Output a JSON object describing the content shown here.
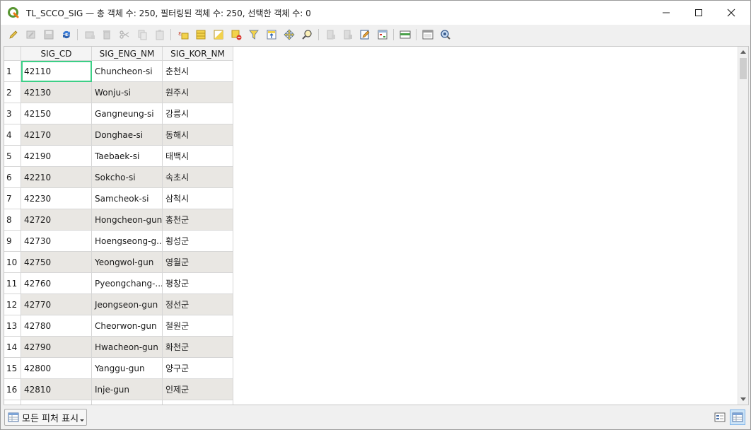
{
  "window": {
    "title": "TL_SCCO_SIG — 총 객체 수: 250, 필터링된 객체 수: 250, 선택한 객체 수: 0"
  },
  "toolbar": {
    "buttons": [
      {
        "name": "toggle-editing-button",
        "icon": "pencil-icon"
      },
      {
        "name": "toggle-multi-edit-button",
        "icon": "multi-edit-icon"
      },
      {
        "name": "save-edits-button",
        "icon": "save-icon"
      },
      {
        "name": "reload-table-button",
        "icon": "reload-icon"
      },
      {
        "name": "add-feature-button",
        "icon": "add-feature-icon"
      },
      {
        "name": "delete-features-button",
        "icon": "delete-icon"
      },
      {
        "name": "cut-features-button",
        "icon": "cut-icon"
      },
      {
        "name": "copy-features-button",
        "icon": "copy-icon"
      },
      {
        "name": "paste-features-button",
        "icon": "paste-icon"
      },
      {
        "name": "select-by-expression-button",
        "icon": "expression-select-icon"
      },
      {
        "name": "select-all-button",
        "icon": "select-all-icon"
      },
      {
        "name": "invert-selection-button",
        "icon": "invert-selection-icon"
      },
      {
        "name": "deselect-all-button",
        "icon": "deselect-icon"
      },
      {
        "name": "filter-select-button",
        "icon": "filter-icon"
      },
      {
        "name": "move-selection-to-top-button",
        "icon": "move-to-top-icon"
      },
      {
        "name": "pan-to-selection-button",
        "icon": "pan-icon"
      },
      {
        "name": "zoom-to-selection-button",
        "icon": "zoom-icon"
      },
      {
        "name": "new-field-button",
        "icon": "new-field-icon"
      },
      {
        "name": "delete-field-button",
        "icon": "delete-field-icon"
      },
      {
        "name": "field-calculator-button",
        "icon": "field-calculator-icon"
      },
      {
        "name": "conditional-formatting-button",
        "icon": "conditional-format-icon"
      },
      {
        "name": "organize-columns-button",
        "icon": "organize-columns-icon"
      },
      {
        "name": "dock-table-button",
        "icon": "dock-icon"
      },
      {
        "name": "actions-button",
        "icon": "actions-icon"
      }
    ]
  },
  "table": {
    "columns": [
      "SIG_CD",
      "SIG_ENG_NM",
      "SIG_KOR_NM"
    ],
    "rows": [
      {
        "n": "1",
        "cd": "42110",
        "eng": "Chuncheon-si",
        "kor": "춘천시"
      },
      {
        "n": "2",
        "cd": "42130",
        "eng": "Wonju-si",
        "kor": "원주시"
      },
      {
        "n": "3",
        "cd": "42150",
        "eng": "Gangneung-si",
        "kor": "강릉시"
      },
      {
        "n": "4",
        "cd": "42170",
        "eng": "Donghae-si",
        "kor": "동해시"
      },
      {
        "n": "5",
        "cd": "42190",
        "eng": "Taebaek-si",
        "kor": "태백시"
      },
      {
        "n": "6",
        "cd": "42210",
        "eng": "Sokcho-si",
        "kor": "속초시"
      },
      {
        "n": "7",
        "cd": "42230",
        "eng": "Samcheok-si",
        "kor": "삼척시"
      },
      {
        "n": "8",
        "cd": "42720",
        "eng": "Hongcheon-gun",
        "kor": "홍천군"
      },
      {
        "n": "9",
        "cd": "42730",
        "eng": "Hoengseong-g...",
        "kor": "횡성군"
      },
      {
        "n": "10",
        "cd": "42750",
        "eng": "Yeongwol-gun",
        "kor": "영월군"
      },
      {
        "n": "11",
        "cd": "42760",
        "eng": "Pyeongchang-...",
        "kor": "평창군"
      },
      {
        "n": "12",
        "cd": "42770",
        "eng": "Jeongseon-gun",
        "kor": "정선군"
      },
      {
        "n": "13",
        "cd": "42780",
        "eng": "Cheorwon-gun",
        "kor": "철원군"
      },
      {
        "n": "14",
        "cd": "42790",
        "eng": "Hwacheon-gun",
        "kor": "화천군"
      },
      {
        "n": "15",
        "cd": "42800",
        "eng": "Yanggu-gun",
        "kor": "양구군"
      },
      {
        "n": "16",
        "cd": "42810",
        "eng": "Inje-gun",
        "kor": "인제군"
      }
    ]
  },
  "statusbar": {
    "filter_label": "모든 피처 표시"
  },
  "colors": {
    "accent": "#3ccf86",
    "alt_row": "#e9e7e3",
    "qgis_green": "#589632"
  }
}
